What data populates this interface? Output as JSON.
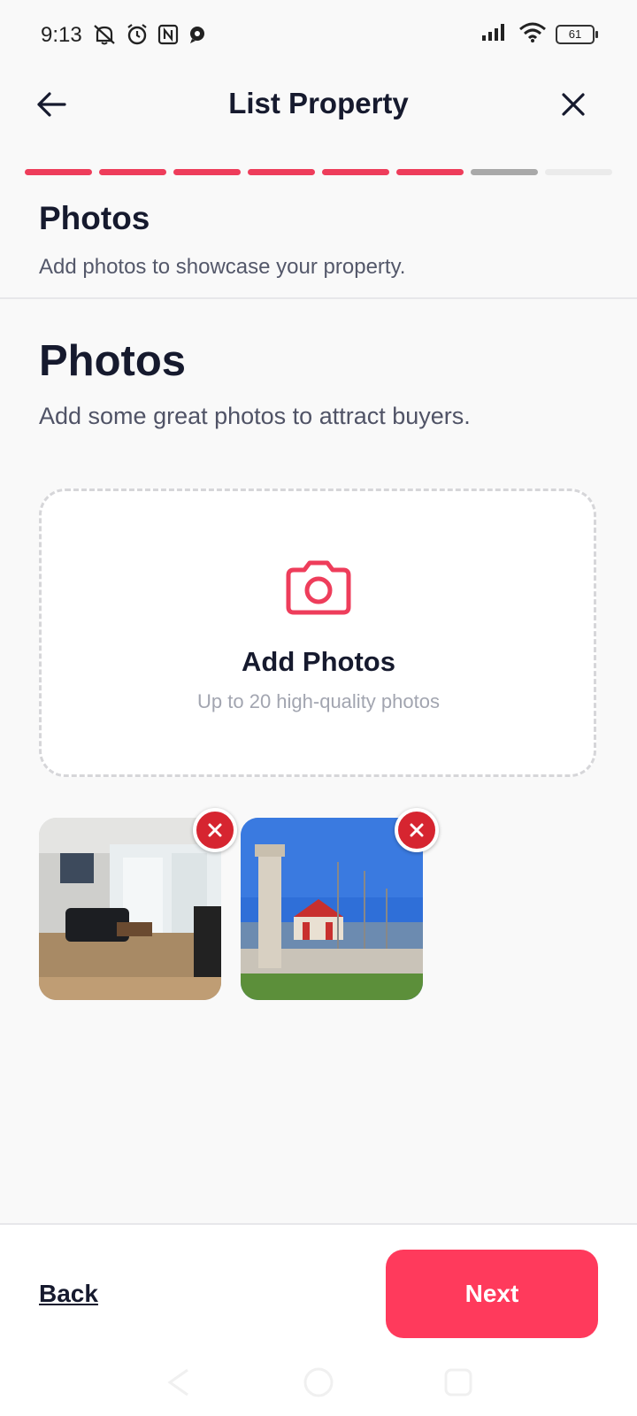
{
  "status_bar": {
    "time": "9:13",
    "battery": "61",
    "icons": [
      "mute-vibrate-icon",
      "alarm-icon",
      "nfc-icon",
      "chat-bubble-icon",
      "signal-icon",
      "wifi-icon",
      "battery-icon"
    ]
  },
  "header": {
    "title": "List Property",
    "back_icon": "arrow-left-icon",
    "close_icon": "close-icon"
  },
  "progress": {
    "steps_total": 8,
    "steps_completed": 6,
    "current_step": 7,
    "colors": {
      "done": "#ee3d5b",
      "current": "#a9a9a9",
      "todo": "#ebebeb"
    }
  },
  "step": {
    "title": "Photos",
    "subtitle": "Add photos to showcase your property."
  },
  "section": {
    "title": "Photos",
    "subtitle": "Add some great photos to attract buyers."
  },
  "dropzone": {
    "icon": "camera-icon",
    "title": "Add Photos",
    "subtitle": "Up to 20 high-quality photos"
  },
  "photos": [
    {
      "subject": "living room",
      "remove_icon": "remove-x-icon"
    },
    {
      "subject": "seaside monument",
      "remove_icon": "remove-x-icon"
    }
  ],
  "footer": {
    "back_label": "Back",
    "next_label": "Next"
  },
  "colors": {
    "accent": "#ff3a5c",
    "remove": "#d62530",
    "text_dark": "#161a2e"
  }
}
